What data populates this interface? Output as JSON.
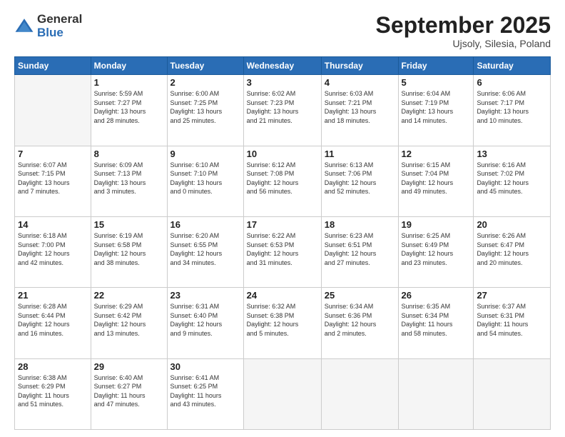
{
  "logo": {
    "general": "General",
    "blue": "Blue"
  },
  "title": "September 2025",
  "location": "Ujsoly, Silesia, Poland",
  "headers": [
    "Sunday",
    "Monday",
    "Tuesday",
    "Wednesday",
    "Thursday",
    "Friday",
    "Saturday"
  ],
  "weeks": [
    [
      {
        "day": "",
        "info": ""
      },
      {
        "day": "1",
        "info": "Sunrise: 5:59 AM\nSunset: 7:27 PM\nDaylight: 13 hours\nand 28 minutes."
      },
      {
        "day": "2",
        "info": "Sunrise: 6:00 AM\nSunset: 7:25 PM\nDaylight: 13 hours\nand 25 minutes."
      },
      {
        "day": "3",
        "info": "Sunrise: 6:02 AM\nSunset: 7:23 PM\nDaylight: 13 hours\nand 21 minutes."
      },
      {
        "day": "4",
        "info": "Sunrise: 6:03 AM\nSunset: 7:21 PM\nDaylight: 13 hours\nand 18 minutes."
      },
      {
        "day": "5",
        "info": "Sunrise: 6:04 AM\nSunset: 7:19 PM\nDaylight: 13 hours\nand 14 minutes."
      },
      {
        "day": "6",
        "info": "Sunrise: 6:06 AM\nSunset: 7:17 PM\nDaylight: 13 hours\nand 10 minutes."
      }
    ],
    [
      {
        "day": "7",
        "info": "Sunrise: 6:07 AM\nSunset: 7:15 PM\nDaylight: 13 hours\nand 7 minutes."
      },
      {
        "day": "8",
        "info": "Sunrise: 6:09 AM\nSunset: 7:13 PM\nDaylight: 13 hours\nand 3 minutes."
      },
      {
        "day": "9",
        "info": "Sunrise: 6:10 AM\nSunset: 7:10 PM\nDaylight: 13 hours\nand 0 minutes."
      },
      {
        "day": "10",
        "info": "Sunrise: 6:12 AM\nSunset: 7:08 PM\nDaylight: 12 hours\nand 56 minutes."
      },
      {
        "day": "11",
        "info": "Sunrise: 6:13 AM\nSunset: 7:06 PM\nDaylight: 12 hours\nand 52 minutes."
      },
      {
        "day": "12",
        "info": "Sunrise: 6:15 AM\nSunset: 7:04 PM\nDaylight: 12 hours\nand 49 minutes."
      },
      {
        "day": "13",
        "info": "Sunrise: 6:16 AM\nSunset: 7:02 PM\nDaylight: 12 hours\nand 45 minutes."
      }
    ],
    [
      {
        "day": "14",
        "info": "Sunrise: 6:18 AM\nSunset: 7:00 PM\nDaylight: 12 hours\nand 42 minutes."
      },
      {
        "day": "15",
        "info": "Sunrise: 6:19 AM\nSunset: 6:58 PM\nDaylight: 12 hours\nand 38 minutes."
      },
      {
        "day": "16",
        "info": "Sunrise: 6:20 AM\nSunset: 6:55 PM\nDaylight: 12 hours\nand 34 minutes."
      },
      {
        "day": "17",
        "info": "Sunrise: 6:22 AM\nSunset: 6:53 PM\nDaylight: 12 hours\nand 31 minutes."
      },
      {
        "day": "18",
        "info": "Sunrise: 6:23 AM\nSunset: 6:51 PM\nDaylight: 12 hours\nand 27 minutes."
      },
      {
        "day": "19",
        "info": "Sunrise: 6:25 AM\nSunset: 6:49 PM\nDaylight: 12 hours\nand 23 minutes."
      },
      {
        "day": "20",
        "info": "Sunrise: 6:26 AM\nSunset: 6:47 PM\nDaylight: 12 hours\nand 20 minutes."
      }
    ],
    [
      {
        "day": "21",
        "info": "Sunrise: 6:28 AM\nSunset: 6:44 PM\nDaylight: 12 hours\nand 16 minutes."
      },
      {
        "day": "22",
        "info": "Sunrise: 6:29 AM\nSunset: 6:42 PM\nDaylight: 12 hours\nand 13 minutes."
      },
      {
        "day": "23",
        "info": "Sunrise: 6:31 AM\nSunset: 6:40 PM\nDaylight: 12 hours\nand 9 minutes."
      },
      {
        "day": "24",
        "info": "Sunrise: 6:32 AM\nSunset: 6:38 PM\nDaylight: 12 hours\nand 5 minutes."
      },
      {
        "day": "25",
        "info": "Sunrise: 6:34 AM\nSunset: 6:36 PM\nDaylight: 12 hours\nand 2 minutes."
      },
      {
        "day": "26",
        "info": "Sunrise: 6:35 AM\nSunset: 6:34 PM\nDaylight: 11 hours\nand 58 minutes."
      },
      {
        "day": "27",
        "info": "Sunrise: 6:37 AM\nSunset: 6:31 PM\nDaylight: 11 hours\nand 54 minutes."
      }
    ],
    [
      {
        "day": "28",
        "info": "Sunrise: 6:38 AM\nSunset: 6:29 PM\nDaylight: 11 hours\nand 51 minutes."
      },
      {
        "day": "29",
        "info": "Sunrise: 6:40 AM\nSunset: 6:27 PM\nDaylight: 11 hours\nand 47 minutes."
      },
      {
        "day": "30",
        "info": "Sunrise: 6:41 AM\nSunset: 6:25 PM\nDaylight: 11 hours\nand 43 minutes."
      },
      {
        "day": "",
        "info": ""
      },
      {
        "day": "",
        "info": ""
      },
      {
        "day": "",
        "info": ""
      },
      {
        "day": "",
        "info": ""
      }
    ]
  ]
}
